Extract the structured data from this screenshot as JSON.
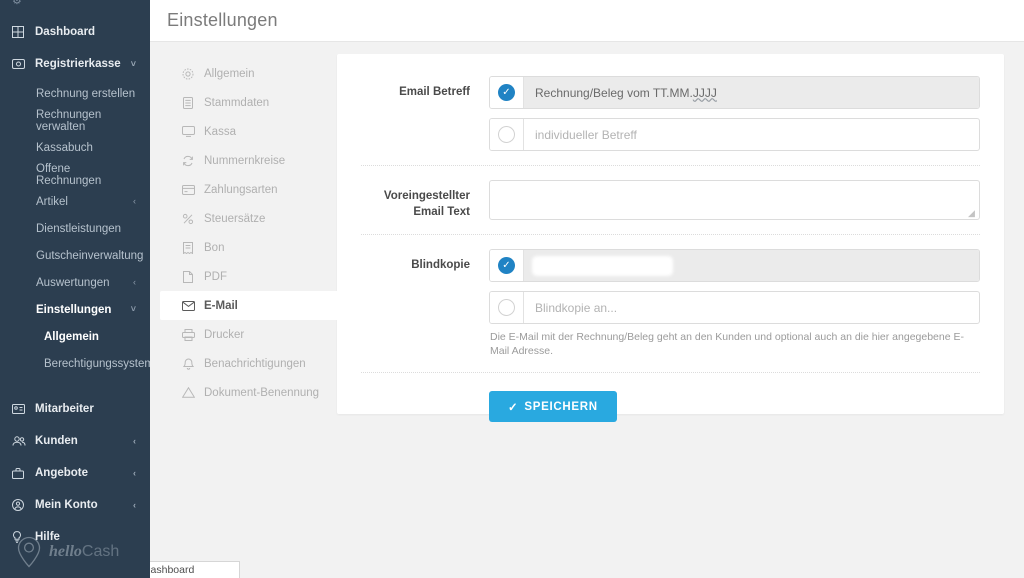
{
  "statusbar": {
    "url": "https://bookgoodlook.at/intern/dashboard"
  },
  "brand": {
    "logo_hello": "hello",
    "logo_cash": "Cash",
    "accent_blue": "#29a9e0",
    "radio_blue": "#2083c4",
    "sidebar_bg": "#2c3e50"
  },
  "sidebar": {
    "items": [
      {
        "label": "Dashboard",
        "icon": "grid-icon",
        "level": 0,
        "caret": "",
        "active": false
      },
      {
        "label": "Registrierkasse",
        "icon": "cash-register-icon",
        "level": 0,
        "caret": "˅",
        "active": false
      },
      {
        "label": "Rechnung erstellen",
        "icon": "",
        "level": 1,
        "caret": "",
        "active": false
      },
      {
        "label": "Rechnungen verwalten",
        "icon": "",
        "level": 1,
        "caret": "",
        "active": false
      },
      {
        "label": "Kassabuch",
        "icon": "",
        "level": 1,
        "caret": "",
        "active": false
      },
      {
        "label": "Offene Rechnungen",
        "icon": "",
        "level": 1,
        "caret": "",
        "active": false
      },
      {
        "label": "Artikel",
        "icon": "",
        "level": 1,
        "caret": "‹",
        "active": false
      },
      {
        "label": "Dienstleistungen",
        "icon": "",
        "level": 1,
        "caret": "",
        "active": false
      },
      {
        "label": "Gutscheinverwaltung",
        "icon": "",
        "level": 1,
        "caret": "",
        "active": false
      },
      {
        "label": "Auswertungen",
        "icon": "",
        "level": 1,
        "caret": "‹",
        "active": false
      },
      {
        "label": "Einstellungen",
        "icon": "",
        "level": 1,
        "caret": "˅",
        "active": true
      },
      {
        "label": "Allgemein",
        "icon": "",
        "level": 2,
        "caret": "",
        "active": true
      },
      {
        "label": "Berechtigungssystem",
        "icon": "",
        "level": 2,
        "caret": "",
        "active": false
      },
      {
        "label": "Mitarbeiter",
        "icon": "id-card-icon",
        "level": 0,
        "caret": "",
        "active": false
      },
      {
        "label": "Kunden",
        "icon": "users-icon",
        "level": 0,
        "caret": "‹",
        "active": false
      },
      {
        "label": "Angebote",
        "icon": "briefcase-icon",
        "level": 0,
        "caret": "‹",
        "active": false
      },
      {
        "label": "Mein Konto",
        "icon": "user-circle-icon",
        "level": 0,
        "caret": "‹",
        "active": false
      },
      {
        "label": "Hilfe",
        "icon": "lightbulb-icon",
        "level": 0,
        "caret": "",
        "active": false
      }
    ]
  },
  "header": {
    "title": "Einstellungen"
  },
  "subnav": {
    "items": [
      {
        "label": "Allgemein",
        "icon": "gear-icon",
        "active": false
      },
      {
        "label": "Stammdaten",
        "icon": "database-icon",
        "active": false
      },
      {
        "label": "Kassa",
        "icon": "monitor-icon",
        "active": false
      },
      {
        "label": "Nummernkreise",
        "icon": "refresh-icon",
        "active": false
      },
      {
        "label": "Zahlungsarten",
        "icon": "credit-card-icon",
        "active": false
      },
      {
        "label": "Steuersätze",
        "icon": "percent-icon",
        "active": false
      },
      {
        "label": "Bon",
        "icon": "receipt-icon",
        "active": false
      },
      {
        "label": "PDF",
        "icon": "file-icon",
        "active": false
      },
      {
        "label": "E-Mail",
        "icon": "envelope-icon",
        "active": true
      },
      {
        "label": "Drucker",
        "icon": "printer-icon",
        "active": false
      },
      {
        "label": "Benachrichtigungen",
        "icon": "bell-icon",
        "active": false
      },
      {
        "label": "Dokument-Benennung",
        "icon": "warning-triangle-icon",
        "active": false
      }
    ]
  },
  "form": {
    "email_subject": {
      "label": "Email Betreff",
      "option_default_selected": true,
      "option_default_value": "Rechnung/Beleg vom TT.MM.",
      "option_default_value_spellflag": "JJJJ",
      "option_custom_selected": false,
      "option_custom_placeholder": "individueller Betreff"
    },
    "email_text": {
      "label_line1": "Voreingestellter",
      "label_line2": "Email Text",
      "value": "",
      "placeholder": ""
    },
    "bcc": {
      "label": "Blindkopie",
      "option_saved_selected": true,
      "option_saved_value": "",
      "option_saved_redacted": true,
      "option_new_selected": false,
      "option_new_placeholder": "Blindkopie an...",
      "helper": "Die E-Mail mit der Rechnung/Beleg geht an den Kunden und optional auch an die hier angegebene E-Mail Adresse."
    },
    "save_button": {
      "label": "SPEICHERN",
      "check": "✓"
    }
  }
}
